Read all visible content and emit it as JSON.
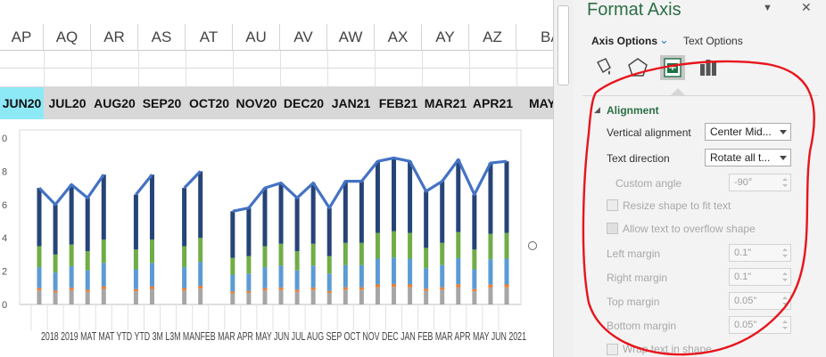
{
  "spreadsheet": {
    "columns": [
      "AP",
      "AQ",
      "AR",
      "AS",
      "AT",
      "AU",
      "AV",
      "AW",
      "AX",
      "AY",
      "AZ",
      "BA"
    ],
    "months": [
      "JUN20",
      "JUL20",
      "AUG20",
      "SEP20",
      "OCT20",
      "NOV20",
      "DEC20",
      "JAN21",
      "FEB21",
      "MAR21",
      "APR21",
      "MAY"
    ],
    "selected_month": "JUN20"
  },
  "chart_data": {
    "type": "bar",
    "stacked": true,
    "y_tick_labels": [
      "0",
      "2",
      "4",
      "6",
      "8",
      "0"
    ],
    "x_axis_overlapping_text": "2018 2019 MAT MAT YTD YTD 3M L3M MANFEB MAR APR MAY JUN JUL AUG SEP OCT NOV DEC JAN FEB MAR APR MAY JUN 2021",
    "ylim": [
      0,
      10
    ],
    "bar_values": [
      7.0,
      6.0,
      7.2,
      6.4,
      7.8,
      0,
      6.6,
      7.8,
      0,
      7.0,
      8.0,
      0,
      5.6,
      5.8,
      7.0,
      7.3,
      6.4,
      7.3,
      5.8,
      7.4,
      7.4,
      8.6,
      8.8,
      8.6,
      6.8,
      7.4,
      8.7,
      6.6,
      8.5,
      8.6
    ],
    "series_colors": [
      "#a6a6a6",
      "#ed7d31",
      "#5b9bd5",
      "#70ad47",
      "#264478"
    ],
    "line_color": "#4472c4",
    "line_gaps_after_index": [
      4,
      7,
      10
    ]
  },
  "format_pane": {
    "title": "Format Axis",
    "tabs": {
      "axis_options": "Axis Options",
      "text_options": "Text Options"
    },
    "icons": [
      "fill-line-icon",
      "effects-icon",
      "size-properties-icon",
      "axis-options-icon"
    ],
    "section_title": "Alignment",
    "rows": {
      "vertical_alignment": {
        "label": "Vertical alignment",
        "value": "Center Mid..."
      },
      "text_direction": {
        "label": "Text direction",
        "value": "Rotate all t..."
      },
      "custom_angle": {
        "label": "Custom angle",
        "value": "-90°"
      },
      "resize_shape": {
        "label": "Resize shape to fit text"
      },
      "allow_overflow": {
        "label": "Allow text to overflow shape"
      },
      "left_margin": {
        "label": "Left margin",
        "value": "0.1\""
      },
      "right_margin": {
        "label": "Right margin",
        "value": "0.1\""
      },
      "top_margin": {
        "label": "Top margin",
        "value": "0.05\""
      },
      "bottom_margin": {
        "label": "Bottom margin",
        "value": "0.05\""
      },
      "wrap_text": {
        "label": "Wrap text in shape"
      }
    }
  },
  "colors": {
    "accent_green": "#2c6f45",
    "annotation_red": "#e8141c",
    "selected_cell": "#8ee9f7"
  }
}
